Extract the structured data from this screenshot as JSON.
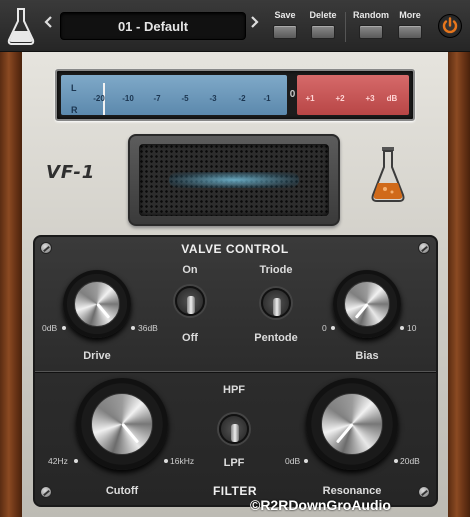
{
  "toolbar": {
    "preset_name": "01 - Default",
    "prev_icon": "chevron-left-icon",
    "next_icon": "chevron-right-icon",
    "save_label": "Save",
    "delete_label": "Delete",
    "random_label": "Random",
    "more_label": "More",
    "power_icon": "power-icon",
    "power_color": "#e8761c"
  },
  "meter": {
    "left_channel": "L",
    "right_channel": "R",
    "ticks_negative": [
      "-20",
      "-10",
      "-7",
      "-5",
      "-3",
      "-2",
      "-1"
    ],
    "zero_label": "0",
    "ticks_positive": [
      "+1",
      "+2",
      "+3",
      "dB"
    ],
    "blue_color": "#6e9abd",
    "red_color": "#c65656"
  },
  "brand": {
    "model": "VF-1"
  },
  "valve_control": {
    "title": "VALVE CONTROL",
    "drive": {
      "label": "Drive",
      "min": "0dB",
      "max": "36dB"
    },
    "switch_on_off": {
      "top": "On",
      "bottom": "Off",
      "state": "Off"
    },
    "switch_mode": {
      "top": "Triode",
      "bottom": "Pentode",
      "state": "Pentode"
    },
    "bias": {
      "label": "Bias",
      "min": "0",
      "max": "10"
    }
  },
  "filter": {
    "title": "FILTER",
    "cutoff": {
      "label": "Cutoff",
      "min": "42Hz",
      "max": "16kHz"
    },
    "switch_type": {
      "top": "HPF",
      "bottom": "LPF",
      "state": "LPF"
    },
    "resonance": {
      "label": "Resonance",
      "min": "0dB",
      "max": "20dB"
    }
  },
  "watermark": "©R2RDownGroAudio"
}
